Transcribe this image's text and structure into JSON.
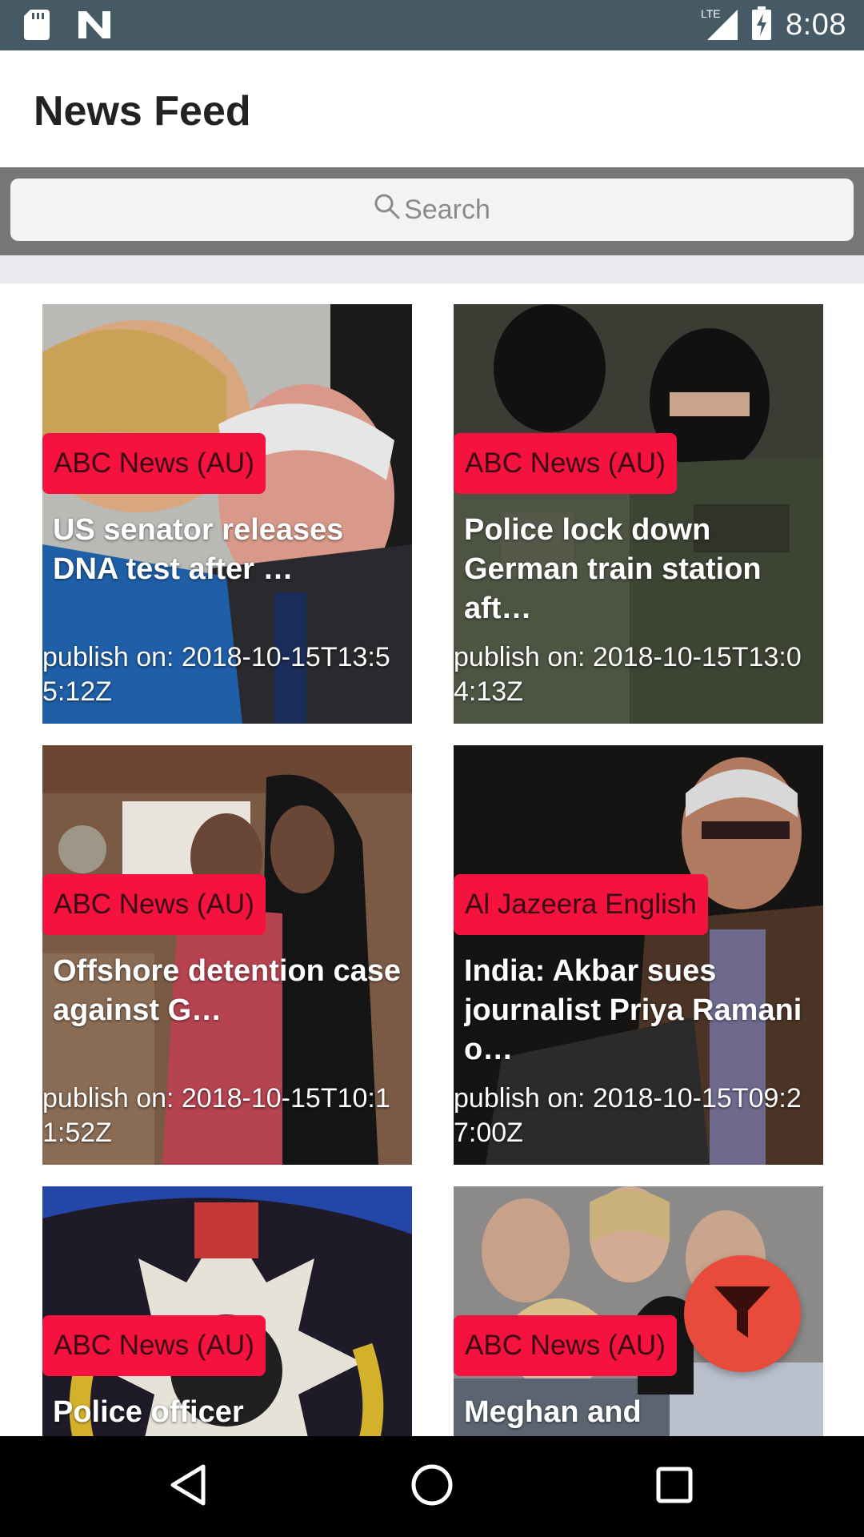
{
  "status_bar": {
    "time": "8:08",
    "network": "LTE",
    "icons": [
      "sd-card-icon",
      "n-logo-icon",
      "lte-signal-icon",
      "battery-charging-icon"
    ]
  },
  "app_bar": {
    "title": "News Feed"
  },
  "search": {
    "placeholder": "Search",
    "icon": "search-icon"
  },
  "articles": [
    {
      "source": "ABC News (AU)",
      "title": "US senator releases DNA test after …",
      "date": "publish on: 2018-10-15T13:55:12Z"
    },
    {
      "source": "ABC News (AU)",
      "title": "Police lock down German train station aft…",
      "date": "publish on: 2018-10-15T13:04:13Z"
    },
    {
      "source": "ABC News (AU)",
      "title": "Offshore detention case against G…",
      "date": "publish on: 2018-10-15T10:11:52Z"
    },
    {
      "source": "Al Jazeera English",
      "title": "India: Akbar sues journalist Priya Ramani o…",
      "date": "publish on: 2018-10-15T09:27:00Z"
    },
    {
      "source": "ABC News (AU)",
      "title": "Police officer",
      "date": ""
    },
    {
      "source": "ABC News (AU)",
      "title": "Meghan and",
      "date": ""
    }
  ],
  "fab": {
    "icon": "filter-icon",
    "color": "#e84a3c"
  },
  "nav_bar": {
    "icons": [
      "back-icon",
      "home-icon",
      "recents-icon"
    ]
  },
  "colors": {
    "status_bar": "#455a64",
    "badge": "#f5123f",
    "search_bg": "#777777"
  }
}
